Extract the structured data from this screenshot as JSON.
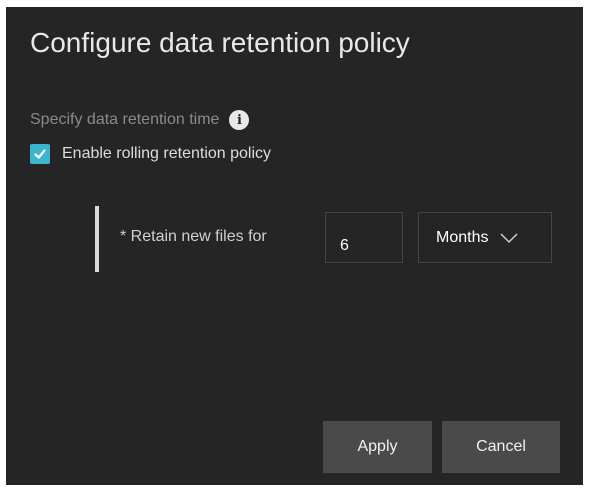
{
  "dialog": {
    "title": "Configure data retention policy",
    "section_label": "Specify data retention time",
    "info_icon": "info-circle-icon",
    "rolling_checkbox": {
      "label": "Enable rolling retention policy",
      "checked": true,
      "accent_color": "#3cb6cf"
    },
    "retain": {
      "label": "* Retain new files for",
      "value": "6",
      "unit": "Months",
      "unit_icon": "chevron-down-icon"
    },
    "buttons": {
      "apply": "Apply",
      "cancel": "Cancel"
    },
    "colors": {
      "background": "#252525",
      "button": "#4a4a4a"
    }
  }
}
